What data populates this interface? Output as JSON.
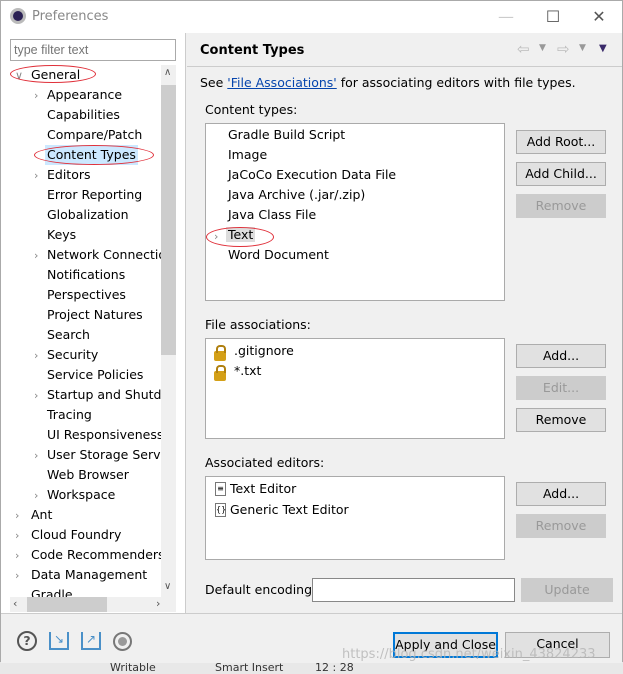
{
  "window": {
    "title": "Preferences",
    "minimize": "—",
    "maximize": "☐",
    "close": "✕"
  },
  "filter": {
    "placeholder": "type filter text"
  },
  "tree": [
    {
      "label": "General",
      "level": 0,
      "expanded": true
    },
    {
      "label": "Appearance",
      "level": 1,
      "arrow": true
    },
    {
      "label": "Capabilities",
      "level": 1
    },
    {
      "label": "Compare/Patch",
      "level": 1
    },
    {
      "label": "Content Types",
      "level": 1,
      "selected": true
    },
    {
      "label": "Editors",
      "level": 1,
      "arrow": true
    },
    {
      "label": "Error Reporting",
      "level": 1
    },
    {
      "label": "Globalization",
      "level": 1
    },
    {
      "label": "Keys",
      "level": 1
    },
    {
      "label": "Network Connectio",
      "level": 1,
      "arrow": true
    },
    {
      "label": "Notifications",
      "level": 1
    },
    {
      "label": "Perspectives",
      "level": 1
    },
    {
      "label": "Project Natures",
      "level": 1
    },
    {
      "label": "Search",
      "level": 1
    },
    {
      "label": "Security",
      "level": 1,
      "arrow": true
    },
    {
      "label": "Service Policies",
      "level": 1
    },
    {
      "label": "Startup and Shutdo",
      "level": 1,
      "arrow": true
    },
    {
      "label": "Tracing",
      "level": 1
    },
    {
      "label": "UI Responsiveness",
      "level": 1
    },
    {
      "label": "User Storage Servic",
      "level": 1,
      "arrow": true
    },
    {
      "label": "Web Browser",
      "level": 1
    },
    {
      "label": "Workspace",
      "level": 1,
      "arrow": true
    },
    {
      "label": "Ant",
      "level": 0,
      "arrow": true
    },
    {
      "label": "Cloud Foundry",
      "level": 0,
      "arrow": true
    },
    {
      "label": "Code Recommenders",
      "level": 0,
      "arrow": true
    },
    {
      "label": "Data Management",
      "level": 0,
      "arrow": true
    },
    {
      "label": "Gradle",
      "level": 0
    }
  ],
  "page": {
    "title": "Content Types",
    "desc_prefix": "See ",
    "desc_link": "'File Associations'",
    "desc_suffix": " for associating editors with file types.",
    "content_types_label": "Content types:",
    "content_types": [
      "Gradle Build Script",
      "Image",
      "JaCoCo Execution Data File",
      "Java Archive (.jar/.zip)",
      "Java Class File",
      "Text",
      "Word Document"
    ],
    "add_root": "Add Root...",
    "add_child": "Add Child...",
    "remove": "Remove",
    "file_assoc_label": "File associations:",
    "file_assoc": [
      ".gitignore",
      "*.txt"
    ],
    "add": "Add...",
    "edit": "Edit...",
    "editors_label": "Associated editors:",
    "editors": [
      "Text Editor",
      "Generic Text Editor"
    ],
    "encoding_label": "Default encoding:",
    "encoding_value": "",
    "update": "Update"
  },
  "footer": {
    "apply_close": "Apply and Close",
    "cancel": "Cancel"
  },
  "behind": {
    "status1": "Writable",
    "status2": "Smart Insert",
    "status3": "12 : 28"
  },
  "watermark": "https://blog.csdn.net/weixin_43824233",
  "colors": {
    "annotation": "#e0303a",
    "link": "#0645ad",
    "focus": "#0078d7"
  }
}
